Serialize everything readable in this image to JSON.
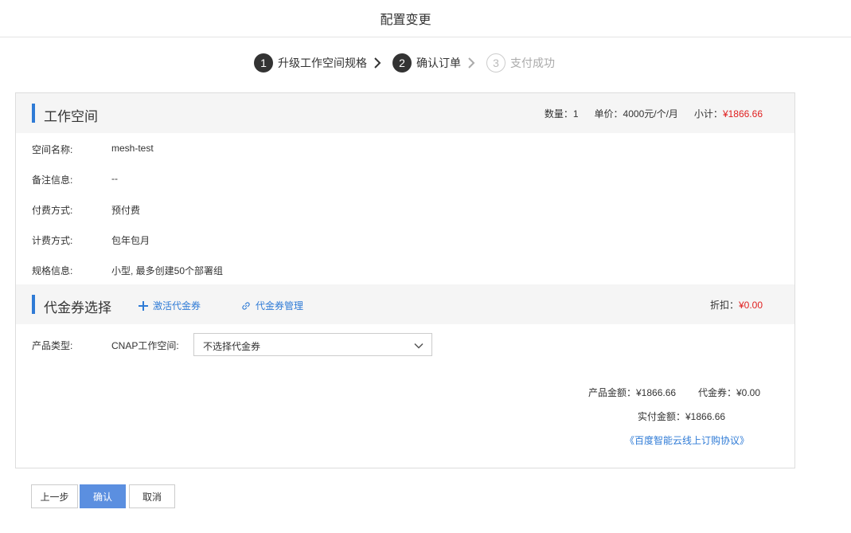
{
  "page": {
    "title": "配置变更"
  },
  "steps": [
    {
      "num": "1",
      "label": "升级工作空间规格"
    },
    {
      "num": "2",
      "label": "确认订单"
    },
    {
      "num": "3",
      "label": "支付成功"
    }
  ],
  "workspace": {
    "title": "工作空间",
    "quantity": "数量：1",
    "unit_price": "单价：4000元/个/月",
    "subtotal_label": "小计：",
    "subtotal_value": "¥1866.66",
    "rows": [
      {
        "key": "空间名称:",
        "value": "mesh-test"
      },
      {
        "key": "备注信息:",
        "value": "--"
      },
      {
        "key": "付费方式:",
        "value": "预付费"
      },
      {
        "key": "计费方式:",
        "value": "包年包月"
      },
      {
        "key": "规格信息:",
        "value": "小型, 最多创建50个部署组"
      }
    ]
  },
  "voucher": {
    "title": "代金券选择",
    "activate_link": "激活代金券",
    "manage_link": "代金券管理",
    "discount_label": "折扣：",
    "discount_value": "¥0.00",
    "product_type_label": "产品类型:",
    "product_name": "CNAP工作空间:",
    "select_value": "不选择代金券"
  },
  "summary": {
    "product_amount": "产品金额：¥1866.66",
    "voucher_amount": "代金券：¥0.00",
    "paid_amount": "实付金额：¥1866.66",
    "agreement": "《百度智能云线上订购协议》"
  },
  "buttons": {
    "prev": "上一步",
    "confirm": "确认",
    "cancel": "取消"
  },
  "colors": {
    "accent": "#2f7bd6",
    "price": "#e02020",
    "primary_button": "#5b8fe0"
  }
}
